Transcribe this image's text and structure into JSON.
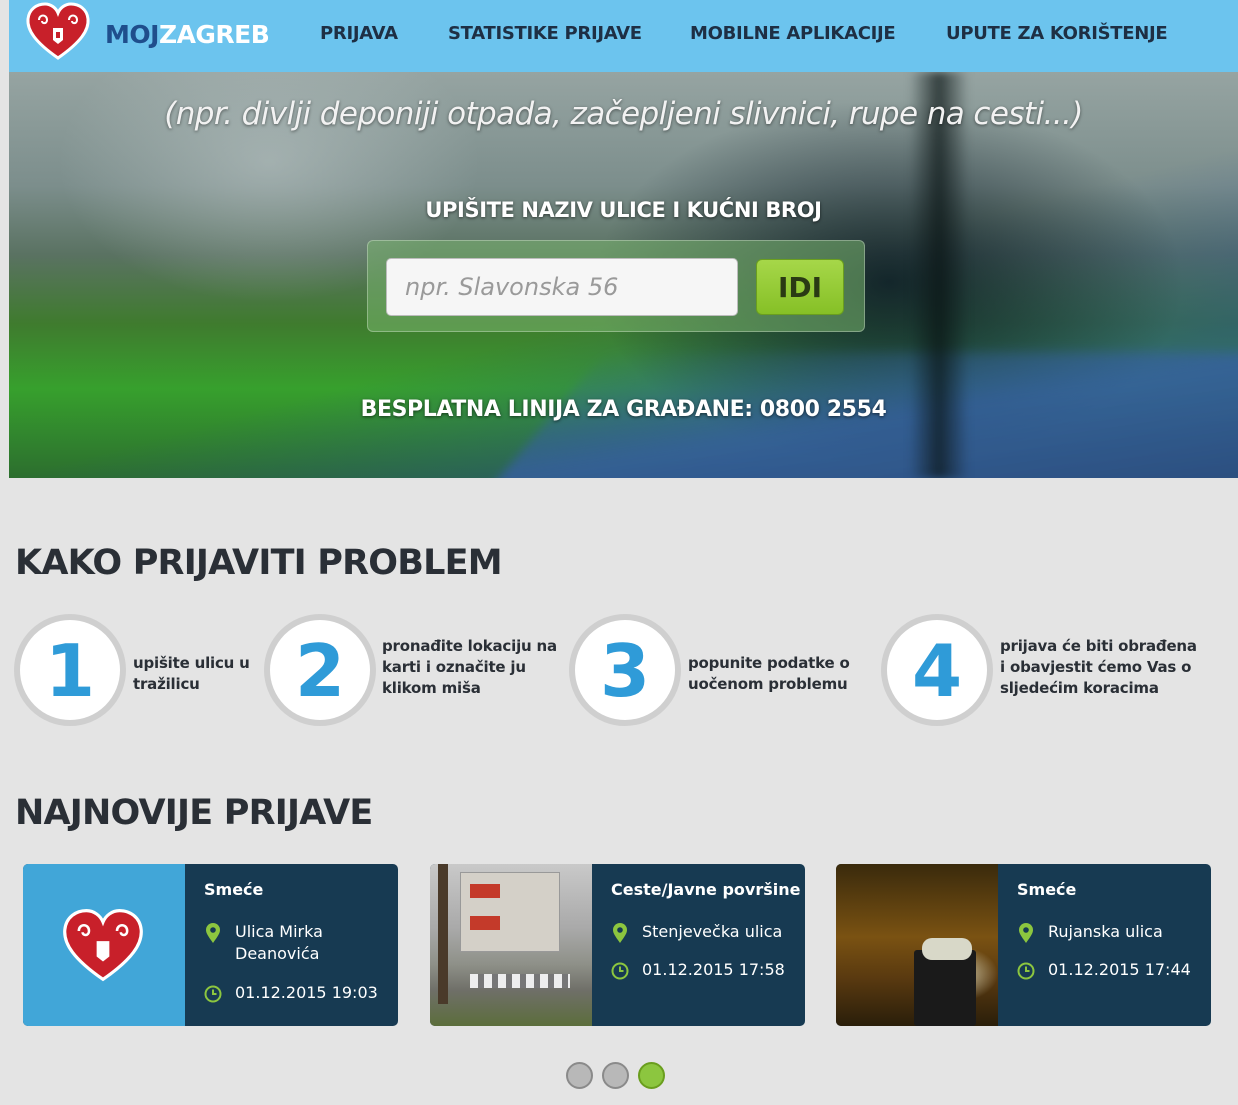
{
  "nav": {
    "brand_part1": "MOJ",
    "brand_part2": "ZAGREB",
    "items": [
      {
        "label": "PRIJAVA"
      },
      {
        "label": "STATISTIKE PRIJAVE"
      },
      {
        "label": "MOBILNE APLIKACIJE"
      },
      {
        "label": "UPUTE ZA KORIŠTENJE"
      }
    ]
  },
  "hero": {
    "subtitle": "(npr. divlji deponiji otpada, začepljeni slivnici, rupe na cesti...)",
    "search_label": "UPIŠITE NAZIV ULICE I KUĆNI BROJ",
    "search_placeholder": "npr. Slavonska 56",
    "search_value": "",
    "search_button": "IDI",
    "hotline": "BESPLATNA LINIJA ZA GRAĐANE: 0800 2554"
  },
  "how_to": {
    "title": "KAKO PRIJAVITI PROBLEM",
    "steps": [
      {
        "number": "1",
        "text": "upišite ulicu u tražilicu"
      },
      {
        "number": "2",
        "text": "pronađite lokaciju na karti i označite ju klikom miša"
      },
      {
        "number": "3",
        "text": "popunite podatke o uočenom problemu"
      },
      {
        "number": "4",
        "text": "prijava će biti obrađena i obavjestit ćemo Vas o sljedećim koracima"
      }
    ]
  },
  "latest": {
    "title": "NAJNOVIJE PRIJAVE",
    "cards": [
      {
        "category": "Smeće",
        "address": "Ulica Mirka Deanovića",
        "datetime": "01.12.2015 19:03",
        "thumbnail": "heart-logo-icon"
      },
      {
        "category": "Ceste/Javne površine",
        "address": "Stenjevečka ulica",
        "datetime": "01.12.2015 17:58",
        "thumbnail": "street-photo"
      },
      {
        "category": "Smeće",
        "address": "Rujanska ulica",
        "datetime": "01.12.2015 17:44",
        "thumbnail": "night-garbage-photo"
      }
    ],
    "carousel": {
      "pages": 3,
      "active_page": 3
    }
  },
  "colors": {
    "nav_bg": "#6cc4ee",
    "brand_dark": "#1f4e8c",
    "card_bg": "#173a52",
    "accent_green": "#8cc63f",
    "step_number": "#2f9bd8",
    "page_bg": "#e4e4e4"
  }
}
